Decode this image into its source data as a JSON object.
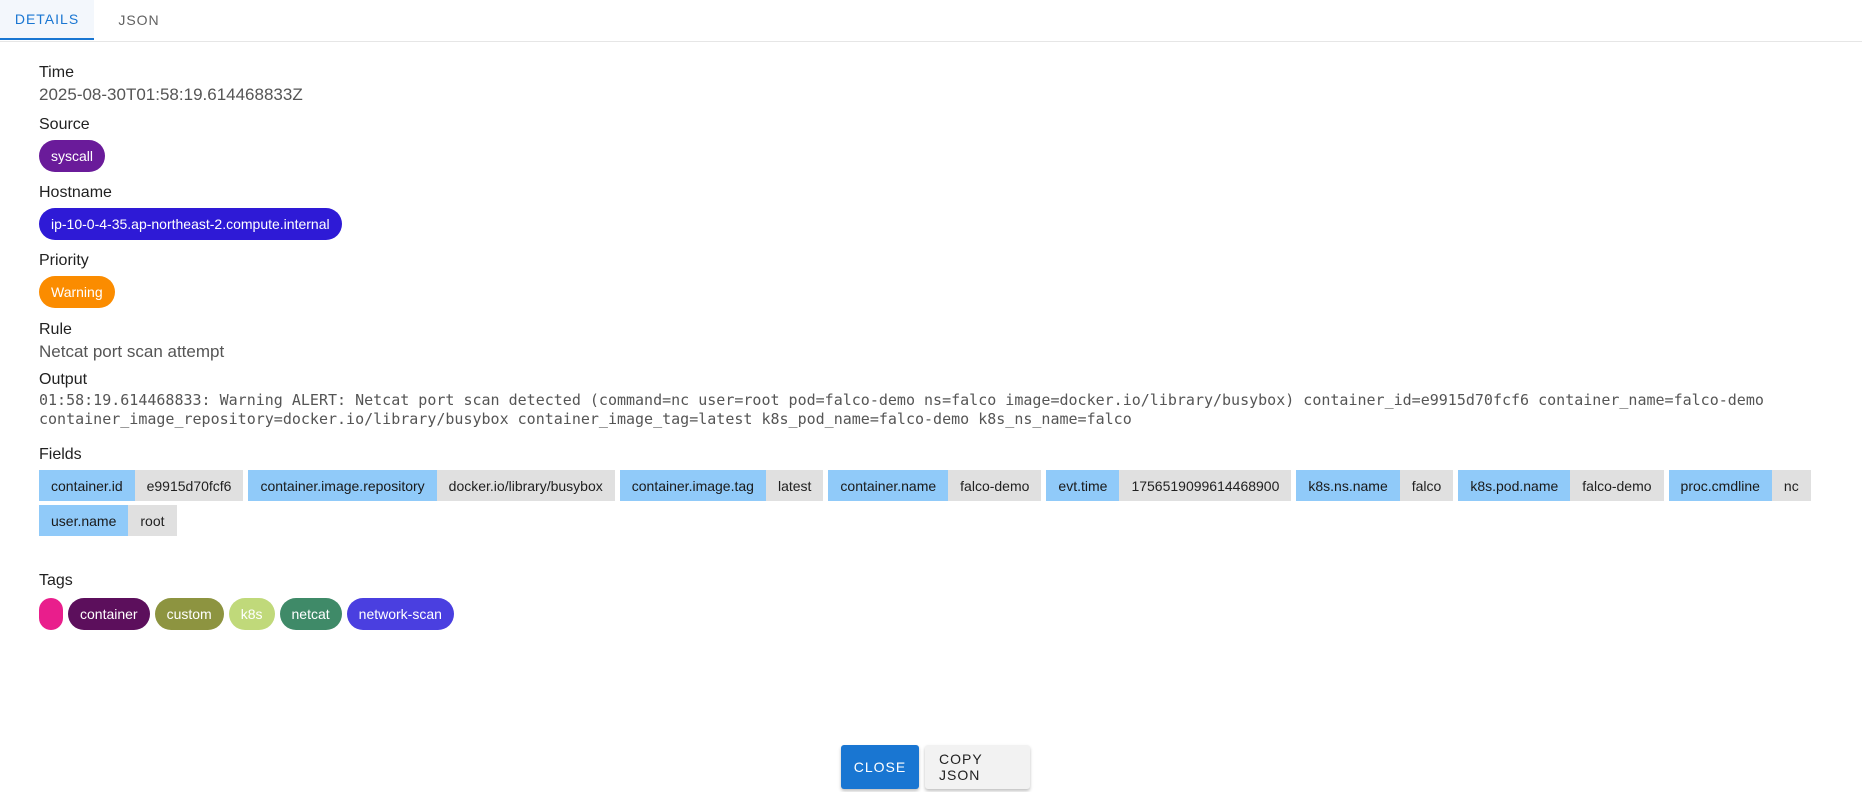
{
  "tabs": [
    {
      "label": "DETAILS",
      "active": true
    },
    {
      "label": "JSON",
      "active": false
    }
  ],
  "details": {
    "time": {
      "label": "Time",
      "value": "2025-08-30T01:58:19.614468833Z"
    },
    "source": {
      "label": "Source",
      "value": "syscall",
      "color": "#6a1b9a"
    },
    "hostname": {
      "label": "Hostname",
      "value": "ip-10-0-4-35.ap-northeast-2.compute.internal",
      "color": "#2e1ad6"
    },
    "priority": {
      "label": "Priority",
      "value": "Warning",
      "color": "#fb8c00"
    },
    "rule": {
      "label": "Rule",
      "value": "Netcat port scan attempt"
    },
    "output": {
      "label": "Output",
      "line1": "01:58:19.614468833: Warning ALERT: Netcat port scan detected (command=nc user=root pod=falco-demo ns=falco image=docker.io/library/busybox) container_id=e9915d70fcf6 container_name=falco-demo",
      "line2": "container_image_repository=docker.io/library/busybox container_image_tag=latest k8s_pod_name=falco-demo k8s_ns_name=falco"
    },
    "fields_label": "Fields",
    "fields": [
      {
        "key": "container.id",
        "value": "e9915d70fcf6"
      },
      {
        "key": "container.image.repository",
        "value": "docker.io/library/busybox"
      },
      {
        "key": "container.image.tag",
        "value": "latest"
      },
      {
        "key": "container.name",
        "value": "falco-demo"
      },
      {
        "key": "evt.time",
        "value": "1756519099614468900"
      },
      {
        "key": "k8s.ns.name",
        "value": "falco"
      },
      {
        "key": "k8s.pod.name",
        "value": "falco-demo"
      },
      {
        "key": "proc.cmdline",
        "value": "nc"
      },
      {
        "key": "user.name",
        "value": "root"
      }
    ],
    "tags_label": "Tags",
    "tags": [
      {
        "label": "",
        "color": "#e91e8c"
      },
      {
        "label": "container",
        "color": "#5c0f5c"
      },
      {
        "label": "custom",
        "color": "#8d9440"
      },
      {
        "label": "k8s",
        "color": "#c0d97a"
      },
      {
        "label": "netcat",
        "color": "#3f8a68"
      },
      {
        "label": "network-scan",
        "color": "#4a3fe0"
      }
    ]
  },
  "actions": {
    "close_label": "CLOSE",
    "copy_label": "COPY JSON"
  }
}
